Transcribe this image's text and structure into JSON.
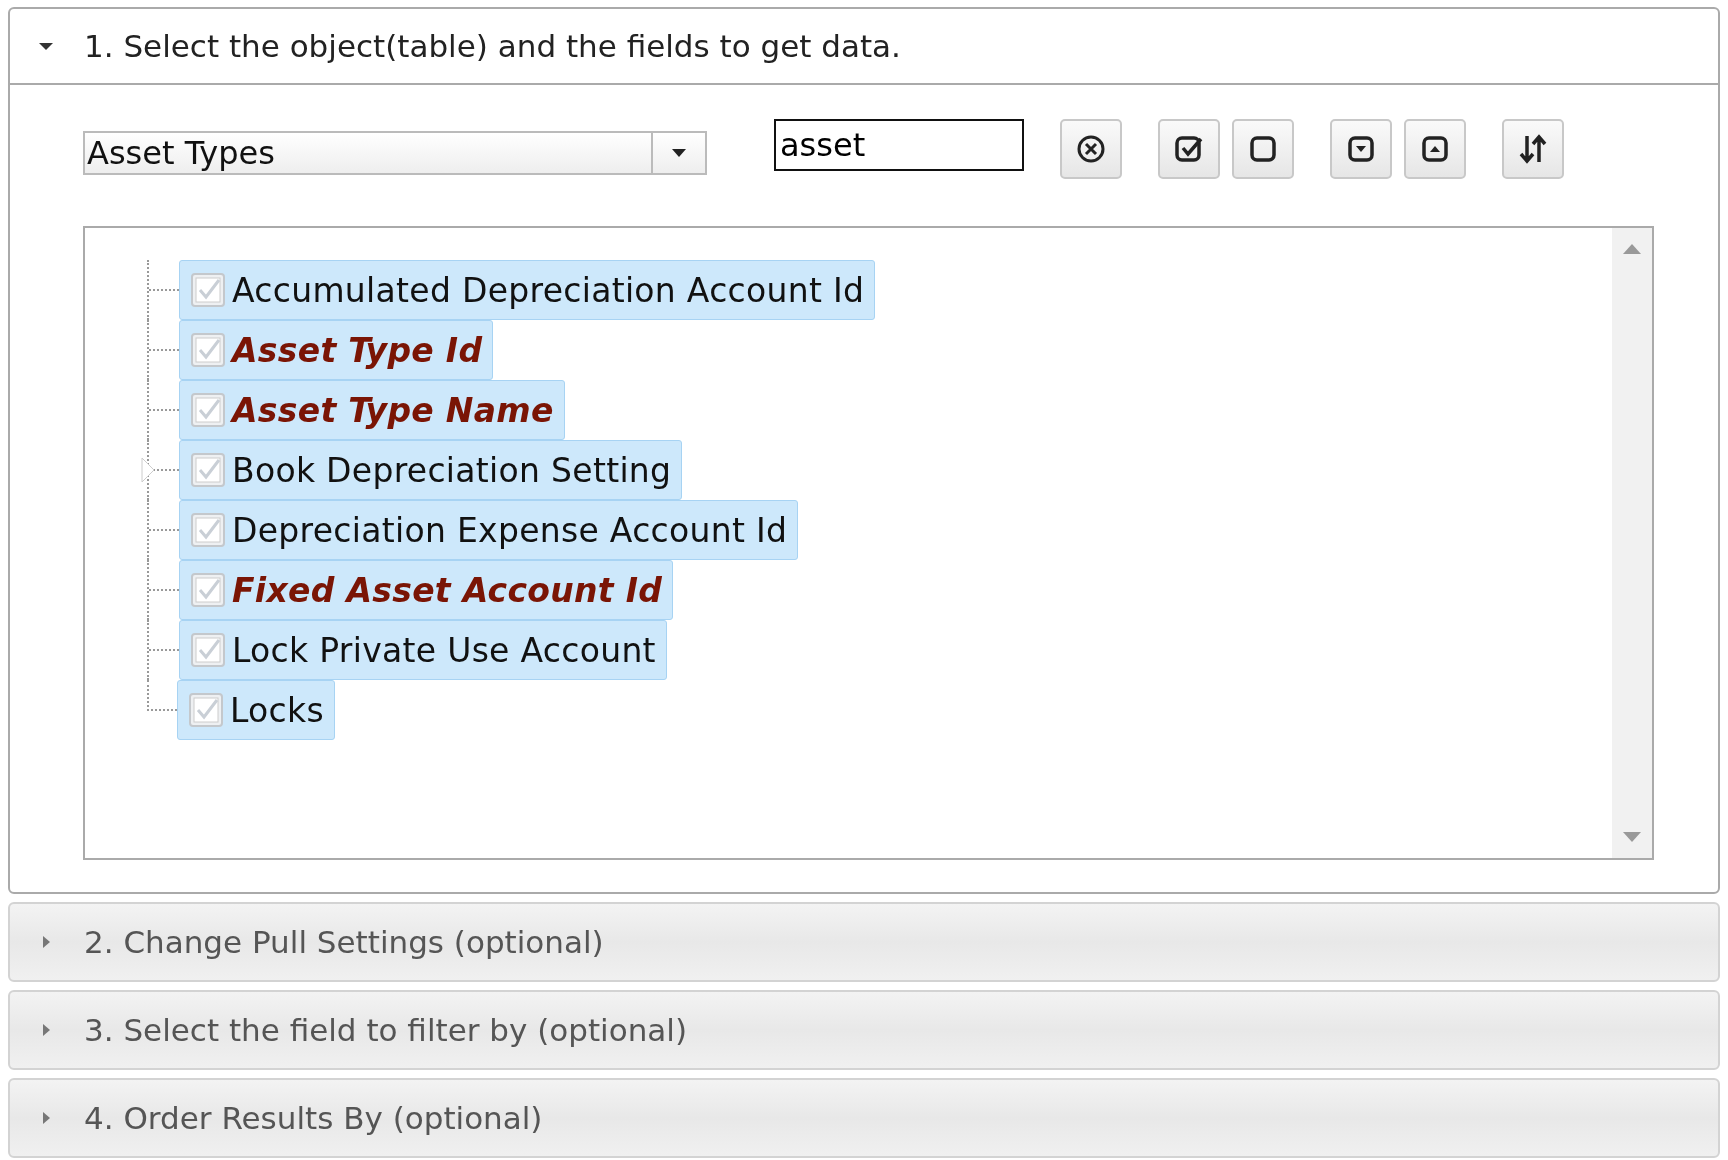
{
  "sections": [
    {
      "title": "1. Select the object(table) and the fields to get data.",
      "expanded": true
    },
    {
      "title": "2. Change Pull Settings (optional)",
      "expanded": false
    },
    {
      "title": "3. Select the field to filter by (optional)",
      "expanded": false
    },
    {
      "title": "4. Order Results By (optional)",
      "expanded": false
    }
  ],
  "object_select": {
    "value": "Asset Types"
  },
  "search": {
    "value": "asset"
  },
  "toolbar": [
    {
      "kind": "clear"
    },
    {
      "kind": "check-all"
    },
    {
      "kind": "uncheck-all"
    },
    {
      "kind": "expand"
    },
    {
      "kind": "collapse"
    },
    {
      "kind": "sort"
    }
  ],
  "fields": [
    {
      "label": "Accumulated Depreciation Account Id",
      "checked": true,
      "selected": true,
      "key": false,
      "kind": "leaf"
    },
    {
      "label": "Asset Type Id",
      "checked": true,
      "selected": true,
      "key": true,
      "kind": "leaf"
    },
    {
      "label": "Asset Type Name",
      "checked": true,
      "selected": true,
      "key": true,
      "kind": "leaf"
    },
    {
      "label": "Book Depreciation Setting",
      "checked": true,
      "selected": true,
      "key": false,
      "kind": "branch",
      "expanded": false
    },
    {
      "label": "Depreciation Expense Account Id",
      "checked": true,
      "selected": true,
      "key": false,
      "kind": "leaf"
    },
    {
      "label": "Fixed Asset Account Id",
      "checked": true,
      "selected": true,
      "key": true,
      "kind": "leaf"
    },
    {
      "label": "Lock Private Use Account",
      "checked": true,
      "selected": true,
      "key": false,
      "kind": "leaf"
    },
    {
      "label": "Locks",
      "checked": true,
      "selected": true,
      "key": false,
      "kind": "leaf"
    }
  ]
}
